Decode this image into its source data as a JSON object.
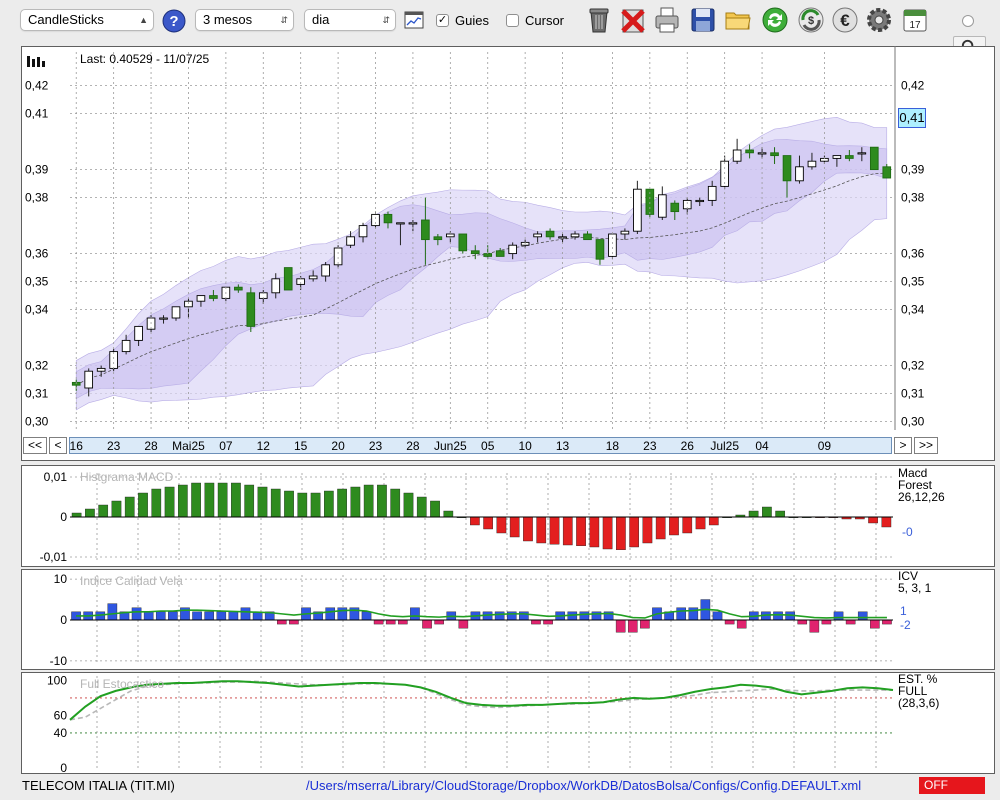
{
  "toolbar": {
    "chart_type": "CandleSticks",
    "period": "3 mesos",
    "interval": "dia",
    "guides_label": "Guies",
    "guides_checked": true,
    "cursor_label": "Cursor",
    "cursor_checked": false,
    "calendar_day": "17",
    "icons": [
      "help-icon",
      "line-chart-icon",
      "trash-icon",
      "delete-icon",
      "print-icon",
      "save-icon",
      "folder-icon",
      "refresh-icon",
      "dollar-cycle-icon",
      "euro-icon",
      "gear-icon",
      "calendar-icon"
    ]
  },
  "main_chart": {
    "last_label": "Last: 0.40529 - 11/07/25",
    "current_price_badge": "0,41"
  },
  "nav": {
    "prev_all": "<<",
    "prev": "<",
    "next": ">",
    "next_all": ">>"
  },
  "panels": {
    "macd": {
      "title": "Histgrama MACD",
      "label1": "Macd",
      "label2": "Forest",
      "label3": "26,12,26",
      "value": "-0",
      "ticks": [
        "0,01",
        "0",
        "-0,01"
      ]
    },
    "icv": {
      "title": "Indice Calidad Vela",
      "label1": "ICV",
      "label2": "5, 3, 1",
      "value1": "1",
      "value2": "-2",
      "ticks": [
        "10",
        "0",
        "-10"
      ]
    },
    "stoch": {
      "title": "Full Estocastico",
      "label1": "EST. %",
      "label2": "FULL",
      "label3": "(28,3,6)",
      "ticks": [
        "100",
        "60",
        "40",
        "0"
      ]
    }
  },
  "status_bar": {
    "security": "TELECOM ITALIA (TIT.MI)",
    "config_path": "/Users/mserra/Library/CloudStorage/Dropbox/WorkDB/DatosBolsa/Configs/Config.DEFAULT.xml",
    "mode": "OFF"
  },
  "colors": {
    "up": "#2e8b1e",
    "down": "#e31f1f",
    "bar_blue": "#2f56e0",
    "bar_pink": "#e0236e",
    "band": "#d6d0f2",
    "accent": "#3a5fd9"
  },
  "chart_data": [
    {
      "type": "candlestick",
      "title": "",
      "y_ticks": [
        "0,30",
        "0,31",
        "0,32",
        "0,34",
        "0,35",
        "0,36",
        "0,38",
        "0,39",
        "0,41",
        "0,42"
      ],
      "x_ticks": [
        "16",
        "23",
        "28",
        "Mai25",
        "07",
        "12",
        "15",
        "20",
        "23",
        "28",
        "Jun25",
        "05",
        "10",
        "13",
        "18",
        "23",
        "26",
        "Jul25",
        "04",
        "09"
      ],
      "ylim": [
        0.297,
        0.432
      ],
      "candles": [
        {
          "o": 0.314,
          "h": 0.315,
          "l": 0.311,
          "c": 0.313
        },
        {
          "o": 0.312,
          "h": 0.319,
          "l": 0.309,
          "c": 0.318
        },
        {
          "o": 0.318,
          "h": 0.32,
          "l": 0.316,
          "c": 0.319
        },
        {
          "o": 0.319,
          "h": 0.326,
          "l": 0.318,
          "c": 0.325
        },
        {
          "o": 0.325,
          "h": 0.331,
          "l": 0.324,
          "c": 0.329
        },
        {
          "o": 0.329,
          "h": 0.334,
          "l": 0.327,
          "c": 0.334
        },
        {
          "o": 0.333,
          "h": 0.338,
          "l": 0.332,
          "c": 0.337
        },
        {
          "o": 0.337,
          "h": 0.338,
          "l": 0.335,
          "c": 0.337
        },
        {
          "o": 0.337,
          "h": 0.341,
          "l": 0.336,
          "c": 0.341
        },
        {
          "o": 0.341,
          "h": 0.344,
          "l": 0.337,
          "c": 0.343
        },
        {
          "o": 0.343,
          "h": 0.345,
          "l": 0.341,
          "c": 0.345
        },
        {
          "o": 0.345,
          "h": 0.347,
          "l": 0.343,
          "c": 0.344
        },
        {
          "o": 0.344,
          "h": 0.348,
          "l": 0.343,
          "c": 0.348
        },
        {
          "o": 0.348,
          "h": 0.349,
          "l": 0.346,
          "c": 0.347
        },
        {
          "o": 0.346,
          "h": 0.348,
          "l": 0.332,
          "c": 0.334
        },
        {
          "o": 0.344,
          "h": 0.347,
          "l": 0.342,
          "c": 0.346
        },
        {
          "o": 0.346,
          "h": 0.353,
          "l": 0.344,
          "c": 0.351
        },
        {
          "o": 0.355,
          "h": 0.355,
          "l": 0.347,
          "c": 0.347
        },
        {
          "o": 0.349,
          "h": 0.352,
          "l": 0.347,
          "c": 0.351
        },
        {
          "o": 0.351,
          "h": 0.354,
          "l": 0.35,
          "c": 0.352
        },
        {
          "o": 0.352,
          "h": 0.357,
          "l": 0.35,
          "c": 0.356
        },
        {
          "o": 0.356,
          "h": 0.363,
          "l": 0.355,
          "c": 0.362
        },
        {
          "o": 0.363,
          "h": 0.368,
          "l": 0.362,
          "c": 0.366
        },
        {
          "o": 0.366,
          "h": 0.371,
          "l": 0.364,
          "c": 0.37
        },
        {
          "o": 0.37,
          "h": 0.375,
          "l": 0.369,
          "c": 0.374
        },
        {
          "o": 0.374,
          "h": 0.375,
          "l": 0.369,
          "c": 0.371
        },
        {
          "o": 0.371,
          "h": 0.371,
          "l": 0.363,
          "c": 0.371
        },
        {
          "o": 0.371,
          "h": 0.372,
          "l": 0.368,
          "c": 0.371
        },
        {
          "o": 0.372,
          "h": 0.38,
          "l": 0.356,
          "c": 0.365
        },
        {
          "o": 0.366,
          "h": 0.367,
          "l": 0.363,
          "c": 0.365
        },
        {
          "o": 0.366,
          "h": 0.368,
          "l": 0.364,
          "c": 0.367
        },
        {
          "o": 0.367,
          "h": 0.367,
          "l": 0.36,
          "c": 0.361
        },
        {
          "o": 0.361,
          "h": 0.363,
          "l": 0.358,
          "c": 0.36
        },
        {
          "o": 0.36,
          "h": 0.363,
          "l": 0.358,
          "c": 0.359
        },
        {
          "o": 0.361,
          "h": 0.362,
          "l": 0.359,
          "c": 0.359
        },
        {
          "o": 0.36,
          "h": 0.364,
          "l": 0.358,
          "c": 0.363
        },
        {
          "o": 0.363,
          "h": 0.365,
          "l": 0.362,
          "c": 0.364
        },
        {
          "o": 0.366,
          "h": 0.368,
          "l": 0.364,
          "c": 0.367
        },
        {
          "o": 0.368,
          "h": 0.369,
          "l": 0.365,
          "c": 0.366
        },
        {
          "o": 0.366,
          "h": 0.367,
          "l": 0.364,
          "c": 0.366
        },
        {
          "o": 0.366,
          "h": 0.368,
          "l": 0.365,
          "c": 0.367
        },
        {
          "o": 0.367,
          "h": 0.368,
          "l": 0.365,
          "c": 0.365
        },
        {
          "o": 0.365,
          "h": 0.365,
          "l": 0.356,
          "c": 0.358
        },
        {
          "o": 0.359,
          "h": 0.367,
          "l": 0.358,
          "c": 0.367
        },
        {
          "o": 0.367,
          "h": 0.369,
          "l": 0.365,
          "c": 0.368
        },
        {
          "o": 0.368,
          "h": 0.386,
          "l": 0.367,
          "c": 0.383
        },
        {
          "o": 0.383,
          "h": 0.383,
          "l": 0.373,
          "c": 0.374
        },
        {
          "o": 0.373,
          "h": 0.384,
          "l": 0.372,
          "c": 0.381
        },
        {
          "o": 0.378,
          "h": 0.379,
          "l": 0.372,
          "c": 0.375
        },
        {
          "o": 0.376,
          "h": 0.38,
          "l": 0.374,
          "c": 0.379
        },
        {
          "o": 0.379,
          "h": 0.38,
          "l": 0.377,
          "c": 0.379
        },
        {
          "o": 0.379,
          "h": 0.386,
          "l": 0.377,
          "c": 0.384
        },
        {
          "o": 0.384,
          "h": 0.395,
          "l": 0.383,
          "c": 0.393
        },
        {
          "o": 0.393,
          "h": 0.401,
          "l": 0.392,
          "c": 0.397
        },
        {
          "o": 0.397,
          "h": 0.399,
          "l": 0.394,
          "c": 0.396
        },
        {
          "o": 0.396,
          "h": 0.398,
          "l": 0.394,
          "c": 0.396
        },
        {
          "o": 0.396,
          "h": 0.398,
          "l": 0.392,
          "c": 0.395
        },
        {
          "o": 0.395,
          "h": 0.395,
          "l": 0.38,
          "c": 0.386
        },
        {
          "o": 0.386,
          "h": 0.395,
          "l": 0.385,
          "c": 0.391
        },
        {
          "o": 0.391,
          "h": 0.396,
          "l": 0.39,
          "c": 0.393
        },
        {
          "o": 0.393,
          "h": 0.395,
          "l": 0.392,
          "c": 0.394
        },
        {
          "o": 0.394,
          "h": 0.395,
          "l": 0.391,
          "c": 0.395
        },
        {
          "o": 0.395,
          "h": 0.397,
          "l": 0.393,
          "c": 0.394
        },
        {
          "o": 0.396,
          "h": 0.398,
          "l": 0.393,
          "c": 0.396
        },
        {
          "o": 0.398,
          "h": 0.398,
          "l": 0.39,
          "c": 0.39
        },
        {
          "o": 0.391,
          "h": 0.392,
          "l": 0.387,
          "c": 0.387
        }
      ]
    },
    {
      "type": "bar",
      "title": "Histgrama MACD",
      "ylim": [
        -0.011,
        0.011
      ],
      "values": [
        0.001,
        0.002,
        0.003,
        0.004,
        0.005,
        0.006,
        0.007,
        0.0075,
        0.008,
        0.0085,
        0.0085,
        0.0085,
        0.0085,
        0.008,
        0.0075,
        0.007,
        0.0065,
        0.006,
        0.006,
        0.0065,
        0.007,
        0.0075,
        0.008,
        0.008,
        0.007,
        0.006,
        0.005,
        0.004,
        0.0015,
        0,
        -0.002,
        -0.003,
        -0.004,
        -0.005,
        -0.006,
        -0.0065,
        -0.0068,
        -0.007,
        -0.0072,
        -0.0075,
        -0.008,
        -0.0082,
        -0.0075,
        -0.0065,
        -0.0055,
        -0.0045,
        -0.004,
        -0.003,
        -0.002,
        0,
        0.0005,
        0.0015,
        0.0025,
        0.0015,
        0,
        0,
        -0.0002,
        -0.0002,
        -0.0005,
        -0.0005,
        -0.0015,
        -0.0025
      ]
    },
    {
      "type": "bar",
      "title": "Indice Calidad Vela",
      "ylim": [
        -11,
        11
      ],
      "values": [
        2,
        2,
        2,
        4,
        2,
        3,
        2,
        2,
        2,
        3,
        2,
        2,
        2,
        2,
        3,
        2,
        2,
        -1,
        -1,
        3,
        2,
        3,
        3,
        3,
        2,
        -1,
        -1,
        -1,
        3,
        -2,
        -1,
        2,
        -2,
        2,
        2,
        2,
        2,
        2,
        -1,
        -1,
        2,
        2,
        2,
        2,
        2,
        -3,
        -3,
        -2,
        3,
        2,
        3,
        3,
        5,
        2,
        -1,
        -2,
        2,
        2,
        2,
        2,
        -1,
        -3,
        -1,
        2,
        -1,
        2,
        -2,
        -1
      ],
      "signal_line": [
        1,
        1,
        1.2,
        1.5,
        1.8,
        2,
        2,
        2.2,
        2.2,
        2.4,
        2.4,
        2.3,
        2.2,
        2.1,
        2,
        1.9,
        1.8,
        1.5,
        1.2,
        1.5,
        1.7,
        2,
        2.3,
        2.4,
        2.2,
        1.5,
        1,
        0.8,
        1,
        0.8,
        0.7,
        0.9,
        0.8,
        1,
        1.2,
        1.4,
        1.5,
        1.5,
        1.2,
        0.9,
        1,
        1.2,
        1.4,
        1.5,
        1.6,
        1.2,
        0.6,
        0.5,
        1.5,
        1.9,
        2.2,
        2.3,
        2.6,
        2.4,
        1.5,
        0.8,
        0.9,
        1.2,
        1.3,
        1.2,
        0.9,
        0.6,
        0.5,
        0.6,
        0.6,
        0.6,
        0.6,
        0.6
      ]
    },
    {
      "type": "line",
      "title": "Full Estocastico",
      "ylim": [
        0,
        105
      ],
      "series": [
        {
          "name": "%K",
          "values": [
            55,
            70,
            82,
            88,
            92,
            95,
            96,
            97,
            97,
            98,
            99,
            99,
            98,
            97,
            95,
            93,
            94,
            95,
            96,
            97,
            97,
            96,
            95,
            92,
            87,
            80,
            74,
            72,
            71,
            71,
            72,
            72,
            73,
            74,
            74,
            75,
            78,
            80,
            79,
            80,
            83,
            87,
            90,
            92,
            95,
            94,
            92,
            87,
            84,
            86,
            88,
            91,
            92,
            91,
            89
          ]
        },
        {
          "name": "%D",
          "values": [
            55,
            58,
            68,
            78,
            88,
            93,
            95,
            96,
            97,
            97,
            98,
            98,
            99,
            98,
            97,
            96,
            95,
            95,
            95,
            96,
            96,
            96,
            95,
            92,
            85,
            78,
            72,
            70,
            69,
            70,
            71,
            72,
            73,
            73,
            74,
            75,
            76,
            78,
            79,
            80,
            81,
            83,
            86,
            87,
            88,
            89,
            90,
            89,
            88,
            88,
            89,
            89,
            89,
            89,
            89
          ]
        }
      ]
    }
  ]
}
